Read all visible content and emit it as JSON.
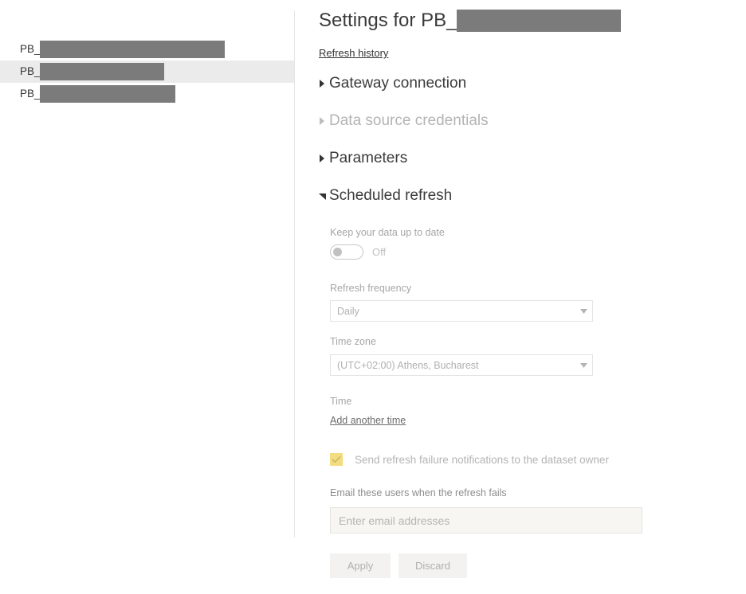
{
  "sidebar": {
    "items": [
      {
        "label": "PB_",
        "redacted_width": 232,
        "selected": false
      },
      {
        "label": "PB_",
        "redacted_width": 156,
        "selected": true
      },
      {
        "label": "PB_",
        "redacted_width": 170,
        "selected": false
      }
    ]
  },
  "header": {
    "title_prefix": "Settings for PB_",
    "title_redacted_width": 206,
    "refresh_history_link": "Refresh history"
  },
  "sections": [
    {
      "label": "Gateway connection",
      "expanded": false,
      "disabled": false,
      "icon": "triangle-right-icon"
    },
    {
      "label": "Data source credentials",
      "expanded": false,
      "disabled": true,
      "icon": "triangle-right-icon"
    },
    {
      "label": "Parameters",
      "expanded": false,
      "disabled": false,
      "icon": "triangle-right-icon"
    },
    {
      "label": "Scheduled refresh",
      "expanded": true,
      "disabled": false,
      "icon": "triangle-down-icon"
    }
  ],
  "scheduled_refresh": {
    "keep_updated_label": "Keep your data up to date",
    "toggle_state": "Off",
    "toggle_on": false,
    "refresh_frequency_label": "Refresh frequency",
    "refresh_frequency_value": "Daily",
    "timezone_label": "Time zone",
    "timezone_value": "(UTC+02:00) Athens, Bucharest",
    "time_label": "Time",
    "add_another_time_link": "Add another time",
    "notify_owner_label": "Send refresh failure notifications to the dataset owner",
    "notify_owner_checked": true,
    "email_users_label": "Email these users when the refresh fails",
    "email_input_value": "",
    "email_input_placeholder": "Enter email addresses"
  },
  "actions": {
    "apply_label": "Apply",
    "discard_label": "Discard"
  },
  "colors": {
    "redaction": "#7b7b7b",
    "selected_row": "#ebebeb",
    "checkbox_amber": "#f4dc80",
    "button_bg": "#f3f2f1",
    "disabled_text": "#b4b4b4",
    "email_field_bg": "#f7f6f3"
  }
}
